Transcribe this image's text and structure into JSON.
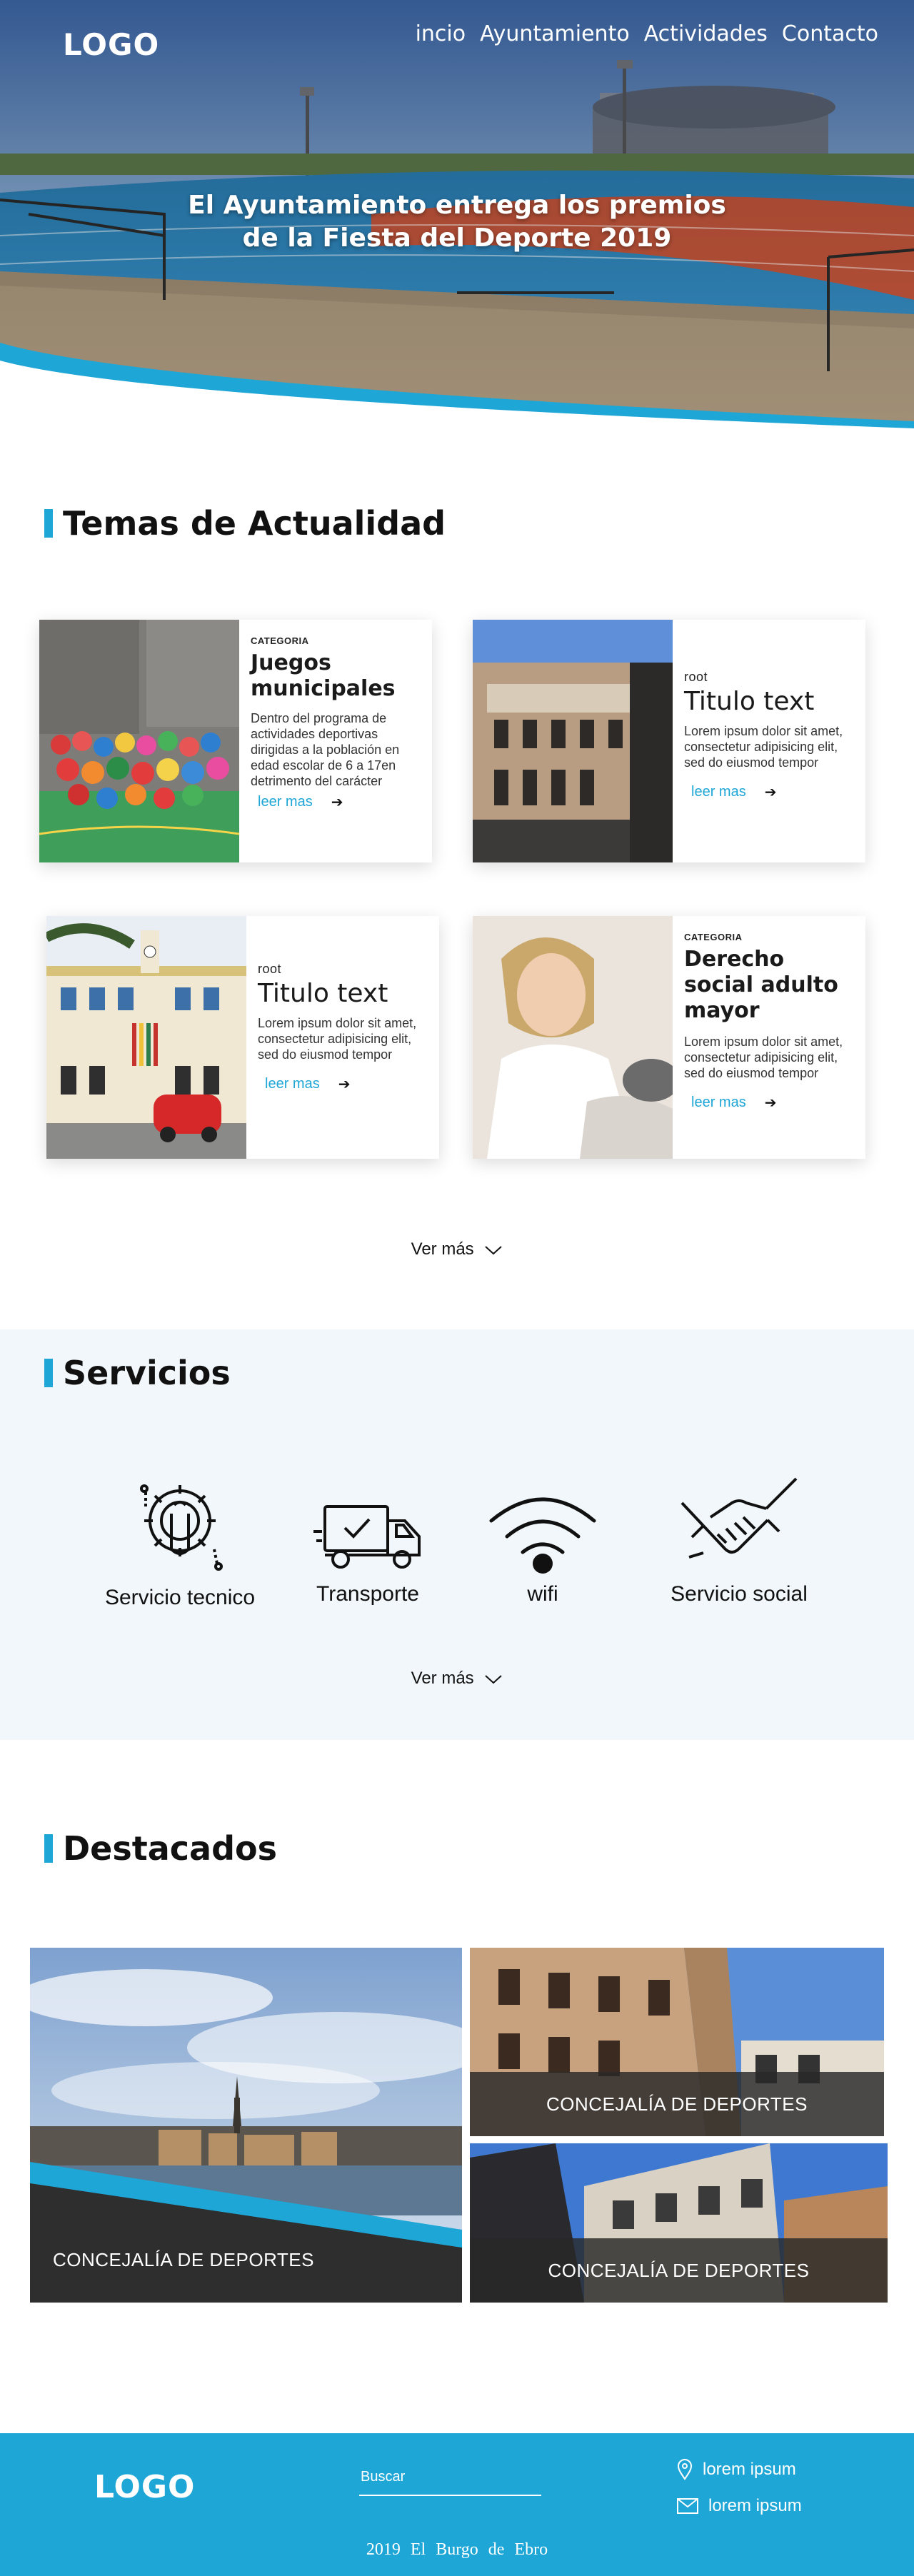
{
  "header": {
    "logo": "LOGO",
    "nav": [
      "incio",
      "Ayuntamiento",
      "Actividades",
      "Contacto"
    ],
    "hero_title_line1": "El Ayuntamiento entrega los premios",
    "hero_title_line2": "de la Fiesta del Deporte 2019"
  },
  "actualidad": {
    "title": "Temas de Actualidad",
    "cards": [
      {
        "category": "CATEGORIA",
        "title": "Juegos municipales",
        "description": "Dentro del programa de actividades deportivas dirigidas a la población en edad escolar de 6 a 17en detrimento del carácter",
        "link": "leer mas"
      },
      {
        "category": "root",
        "title": "Titulo text",
        "description": "Lorem ipsum dolor sit amet, consectetur adipisicing elit, sed do eiusmod tempor",
        "link": "leer mas"
      },
      {
        "category": "root",
        "title": "Titulo text",
        "description": "Lorem ipsum dolor sit amet, consectetur adipisicing elit, sed do eiusmod tempor",
        "link": "leer mas"
      },
      {
        "category": "CATEGORIA",
        "title": "Derecho social adulto mayor",
        "description": "Lorem ipsum dolor sit amet, consectetur adipisicing elit, sed do eiusmod tempor",
        "link": "leer mas"
      }
    ],
    "ver_mas": "Ver más"
  },
  "servicios": {
    "title": "Servicios",
    "items": [
      {
        "label": "Servicio tecnico",
        "icon": "gear-wrench-icon"
      },
      {
        "label": "Transporte",
        "icon": "truck-icon"
      },
      {
        "label": "wifi",
        "icon": "wifi-icon"
      },
      {
        "label": "Servicio social",
        "icon": "handshake-icon"
      }
    ],
    "ver_mas": "Ver más"
  },
  "destacados": {
    "title": "Destacados",
    "items": [
      {
        "caption": "CONCEJALÍA DE DEPORTES"
      },
      {
        "caption": "CONCEJALÍA DE DEPORTES"
      },
      {
        "caption": "CONCEJALÍA DE DEPORTES"
      }
    ]
  },
  "footer": {
    "logo": "LOGO",
    "search_label": "Buscar",
    "location": "lorem ipsum",
    "email": "lorem ipsum",
    "copyright": "2019 El Burgo de Ebro"
  },
  "colors": {
    "accent": "#1ea6d6",
    "footer_bg": "#1ea6d6",
    "servicios_bg": "#f1f7fa"
  }
}
